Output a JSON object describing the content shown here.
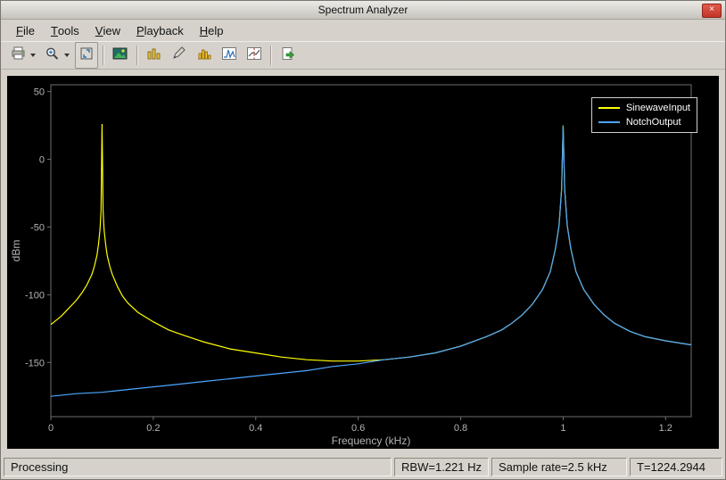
{
  "window": {
    "title": "Spectrum Analyzer",
    "close_glyph": "×"
  },
  "menu": {
    "items": [
      {
        "label": "File"
      },
      {
        "label": "Tools"
      },
      {
        "label": "View"
      },
      {
        "label": "Playback"
      },
      {
        "label": "Help"
      }
    ]
  },
  "toolbar": {
    "buttons": [
      {
        "name": "print",
        "icon": "printer-icon",
        "dropdown": true
      },
      {
        "name": "zoom",
        "icon": "magnifier-icon",
        "dropdown": true
      },
      {
        "name": "fit-to-view",
        "icon": "expand-icon",
        "dropdown": false
      },
      {
        "name": "spectrogram",
        "icon": "image-icon",
        "dropdown": false
      },
      {
        "name": "spectral-mask",
        "icon": "mask-bars-icon",
        "dropdown": false
      },
      {
        "name": "annotate",
        "icon": "pencil-icon",
        "dropdown": false
      },
      {
        "name": "histogram",
        "icon": "histogram-icon",
        "dropdown": false
      },
      {
        "name": "peak-finder",
        "icon": "peak-trace-icon",
        "dropdown": false
      },
      {
        "name": "cursor-measurements",
        "icon": "cursor-trace-icon",
        "dropdown": false
      },
      {
        "name": "export",
        "icon": "page-arrow-icon",
        "dropdown": false
      }
    ]
  },
  "status_bar": {
    "message": "Processing",
    "cells": [
      {
        "name": "rbw",
        "text": "RBW=1.221 Hz",
        "min_width": 104
      },
      {
        "name": "sample-rate",
        "text": "Sample rate=2.5 kHz",
        "min_width": 152
      },
      {
        "name": "time",
        "text": "T=1224.2944",
        "min_width": 104
      }
    ]
  },
  "chart_data": {
    "type": "line",
    "title": "",
    "xlabel": "Frequency (kHz)",
    "ylabel": "dBm",
    "xlim": [
      0,
      1.25
    ],
    "ylim": [
      -190,
      55
    ],
    "xticks": [
      0,
      0.2,
      0.4,
      0.6,
      0.8,
      1,
      1.2
    ],
    "yticks": [
      50,
      0,
      -50,
      -100,
      -150
    ],
    "grid": false,
    "legend_position": "top-right",
    "background": "#000000",
    "axis_color": "#6e6e6e",
    "tick_label_color": "#b4b4b4",
    "series": [
      {
        "name": "SinewaveInput",
        "color": "#ffff00",
        "points": [
          [
            0,
            -122
          ],
          [
            0.01,
            -119
          ],
          [
            0.02,
            -116
          ],
          [
            0.03,
            -112
          ],
          [
            0.04,
            -108
          ],
          [
            0.05,
            -104
          ],
          [
            0.06,
            -99
          ],
          [
            0.07,
            -93
          ],
          [
            0.08,
            -85
          ],
          [
            0.085,
            -79
          ],
          [
            0.09,
            -71
          ],
          [
            0.093,
            -63
          ],
          [
            0.096,
            -52
          ],
          [
            0.098,
            -38
          ],
          [
            0.1,
            26
          ],
          [
            0.102,
            -38
          ],
          [
            0.104,
            -52
          ],
          [
            0.107,
            -63
          ],
          [
            0.11,
            -71
          ],
          [
            0.115,
            -79
          ],
          [
            0.12,
            -85
          ],
          [
            0.13,
            -94
          ],
          [
            0.14,
            -101
          ],
          [
            0.15,
            -106
          ],
          [
            0.17,
            -113
          ],
          [
            0.2,
            -120
          ],
          [
            0.23,
            -126
          ],
          [
            0.26,
            -130
          ],
          [
            0.3,
            -135
          ],
          [
            0.35,
            -140
          ],
          [
            0.4,
            -143
          ],
          [
            0.45,
            -146
          ],
          [
            0.5,
            -148
          ],
          [
            0.55,
            -149
          ],
          [
            0.6,
            -149
          ],
          [
            0.65,
            -148
          ],
          [
            0.7,
            -146
          ],
          [
            0.75,
            -143
          ],
          [
            0.8,
            -138
          ],
          [
            0.85,
            -131
          ],
          [
            0.88,
            -126
          ],
          [
            0.9,
            -121
          ],
          [
            0.92,
            -115
          ],
          [
            0.94,
            -107
          ],
          [
            0.96,
            -96
          ],
          [
            0.975,
            -83
          ],
          [
            0.985,
            -66
          ],
          [
            0.992,
            -49
          ],
          [
            0.997,
            -22
          ],
          [
            1,
            25
          ],
          [
            1.003,
            -22
          ],
          [
            1.008,
            -49
          ],
          [
            1.015,
            -66
          ],
          [
            1.025,
            -83
          ],
          [
            1.04,
            -96
          ],
          [
            1.06,
            -107
          ],
          [
            1.08,
            -115
          ],
          [
            1.1,
            -121
          ],
          [
            1.13,
            -127
          ],
          [
            1.16,
            -131
          ],
          [
            1.2,
            -134
          ],
          [
            1.25,
            -137
          ]
        ]
      },
      {
        "name": "NotchOutput",
        "color": "#4da6ff",
        "points": [
          [
            0,
            -175
          ],
          [
            0.05,
            -173
          ],
          [
            0.1,
            -172
          ],
          [
            0.15,
            -170
          ],
          [
            0.2,
            -168
          ],
          [
            0.25,
            -166
          ],
          [
            0.3,
            -164
          ],
          [
            0.35,
            -162
          ],
          [
            0.4,
            -160
          ],
          [
            0.45,
            -158
          ],
          [
            0.5,
            -156
          ],
          [
            0.55,
            -153
          ],
          [
            0.6,
            -151
          ],
          [
            0.65,
            -148
          ],
          [
            0.7,
            -146
          ],
          [
            0.75,
            -143
          ],
          [
            0.8,
            -138
          ],
          [
            0.85,
            -131
          ],
          [
            0.88,
            -126
          ],
          [
            0.9,
            -121
          ],
          [
            0.92,
            -115
          ],
          [
            0.94,
            -107
          ],
          [
            0.96,
            -96
          ],
          [
            0.975,
            -83
          ],
          [
            0.985,
            -66
          ],
          [
            0.992,
            -49
          ],
          [
            0.997,
            -22
          ],
          [
            1,
            25
          ],
          [
            1.003,
            -22
          ],
          [
            1.008,
            -49
          ],
          [
            1.015,
            -66
          ],
          [
            1.025,
            -83
          ],
          [
            1.04,
            -96
          ],
          [
            1.06,
            -107
          ],
          [
            1.08,
            -115
          ],
          [
            1.1,
            -121
          ],
          [
            1.13,
            -127
          ],
          [
            1.16,
            -131
          ],
          [
            1.2,
            -134
          ],
          [
            1.25,
            -137
          ]
        ]
      }
    ]
  }
}
